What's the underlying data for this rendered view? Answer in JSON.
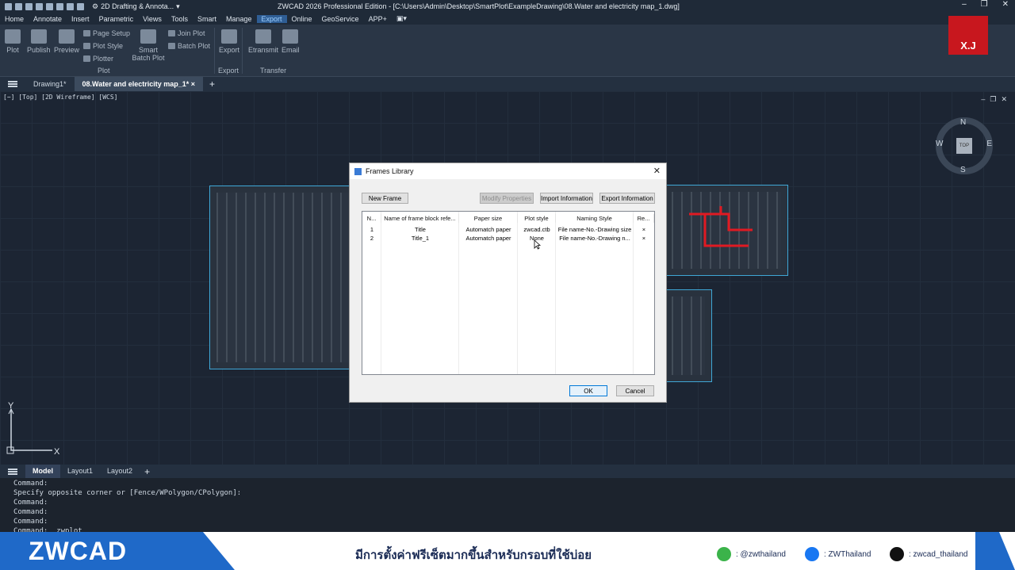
{
  "titlebar": {
    "workspace": "2D Drafting & Annota...",
    "title": "ZWCAD 2026 Professional Edition - [C:\\Users\\Admin\\Desktop\\SmartPlot\\ExampleDrawing\\08.Water and electricity map_1.dwg]"
  },
  "menu": [
    "Home",
    "Annotate",
    "Insert",
    "Parametric",
    "Views",
    "Tools",
    "Smart",
    "Manage",
    "Export",
    "Online",
    "GeoService",
    "APP+"
  ],
  "ribbon": {
    "plot": "Plot",
    "publish": "Publish",
    "preview": "Preview",
    "page_setup": "Page Setup",
    "plot_style": "Plot Style",
    "plotter": "Plotter",
    "smart_batch_plot": "Smart Batch Plot",
    "join_plot": "Join Plot",
    "batch_plot": "Batch Plot",
    "export": "Export",
    "etransmit": "Etransmit",
    "email": "Email",
    "group_plot": "Plot",
    "group_export": "Export",
    "group_transfer": "Transfer"
  },
  "logo": "X.J",
  "doc_tabs": [
    "Drawing1*",
    "08.Water and electricity map_1*"
  ],
  "viewport_label": "[−] [Top] [2D Wireframe] [WCS]",
  "compass": {
    "n": "N",
    "s": "S",
    "e": "E",
    "w": "W",
    "top": "TOP"
  },
  "ucs": {
    "x": "X",
    "y": "Y"
  },
  "dialog": {
    "title": "Frames Library",
    "new_frame": "New Frame",
    "modify_properties": "Modify Properties",
    "import_information": "Import Information",
    "export_information": "Export Information",
    "columns": [
      "N...",
      "Name of frame block refe...",
      "Paper size",
      "Plot style",
      "Naming Style",
      "Re..."
    ],
    "rows": [
      [
        "1",
        "Title",
        "Automatch paper",
        "zwcad.ctb",
        "File name-No.-Drawing size",
        "×"
      ],
      [
        "2",
        "Title_1",
        "Automatch paper",
        "None",
        "File name-No.-Drawing n...",
        "×"
      ]
    ],
    "ok": "OK",
    "cancel": "Cancel"
  },
  "layout_tabs": [
    "Model",
    "Layout1",
    "Layout2"
  ],
  "command_lines": [
    "Command:",
    "Specify opposite corner or [Fence/WPolygon/CPolygon]:",
    "Command:",
    "Command:",
    "Command:",
    "Command: _zwplot"
  ],
  "banner": {
    "brand": "ZWCAD",
    "text": "มีการตั้งค่าฟรีเซ็ตมากขึ้นสำหรับกรอบที่ใช้บ่อย",
    "line": ": @zwthailand",
    "facebook": ": ZWThailand",
    "tiktok": ": zwcad_thailand"
  },
  "colors": {
    "accent": "#2f5e95",
    "brand": "#1f69c8",
    "logo": "#c8171e"
  }
}
